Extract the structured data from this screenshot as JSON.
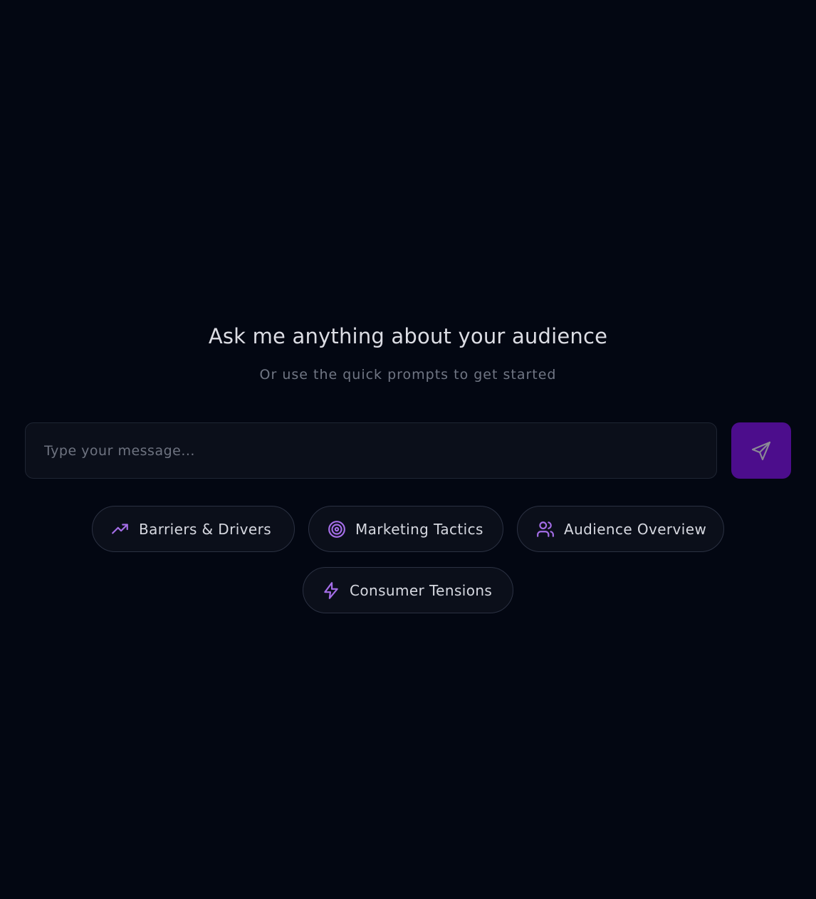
{
  "hero": {
    "title": "Ask me anything about your audience",
    "subtitle": "Or use the quick prompts to get started"
  },
  "composer": {
    "placeholder": "Type your message...",
    "value": "",
    "send_icon": "send-icon"
  },
  "quick_prompts": [
    {
      "label": "Barriers & Drivers",
      "icon": "trending-up-icon"
    },
    {
      "label": "Marketing Tactics",
      "icon": "target-icon"
    },
    {
      "label": "Audience Overview",
      "icon": "users-icon"
    },
    {
      "label": "Consumer Tensions",
      "icon": "lightning-icon"
    }
  ],
  "colors": {
    "background": "#030712",
    "accent": "#a56ee8",
    "send_button": "#4c0d8c"
  }
}
